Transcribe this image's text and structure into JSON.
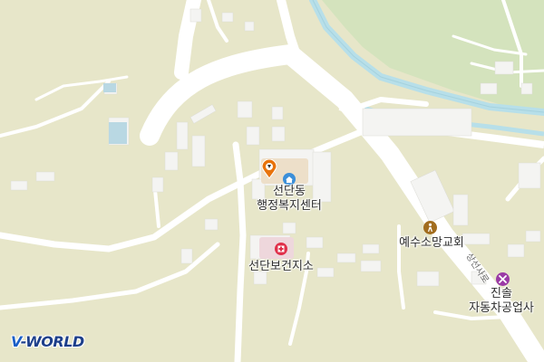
{
  "map": {
    "labels": {
      "admin_center": "선단동\n행정복지센터",
      "church": "예수소망교회",
      "health_center": "선단보건지소",
      "auto_shop": "진솔\n자동차공업사",
      "road": "상선사로"
    },
    "logo": {
      "v": "V",
      "rest": "-WORLD"
    },
    "colors": {
      "land": "#e7e6c9",
      "road": "#ffffff",
      "building": "#f2f2f2",
      "river": "#b7dfe9",
      "park": "#d4e3bd",
      "pin": "#e8730c",
      "church_icon": "#a26d1e",
      "auto_icon": "#9b3aa6",
      "hospital_icon": "#e0304a",
      "admin_icon": "#3c8fd9"
    },
    "icons": [
      "location-pin-icon",
      "home-icon",
      "hospital-icon",
      "person-icon",
      "wrench-icon"
    ]
  }
}
